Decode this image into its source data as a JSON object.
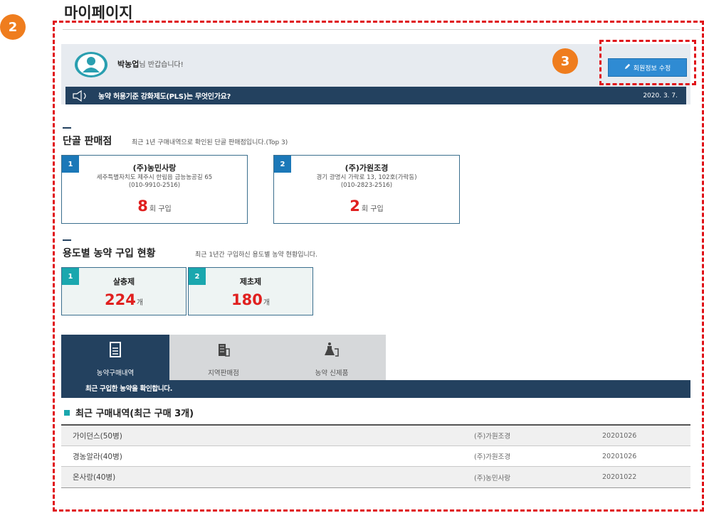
{
  "page": {
    "title": "마이페이지"
  },
  "markers": [
    "2",
    "3"
  ],
  "welcome": {
    "user_name": "박농업",
    "greeting": "님 반갑습니다!",
    "edit_button": "회원정보 수정"
  },
  "notice": {
    "text": "농약 허용기준 강화제도(PLS)는 무엇인가요?",
    "date": "2020. 3. 7."
  },
  "regular_stores": {
    "title": "단골 판매점",
    "subtitle": "최근 1년 구매내역으로 확인된 단골 판매점입니다.(Top 3)",
    "items": [
      {
        "rank": "1",
        "name": "(주)농민사랑",
        "address": "세주특별자치도 제주시 한림읍 금능농공길 65",
        "phone": "(010-9910-2516)",
        "count": "8",
        "unit": "회 구입"
      },
      {
        "rank": "2",
        "name": "(주)가원조경",
        "address": "경기 광명시 가락로 13, 102호(가락동)",
        "phone": "(010-2823-2516)",
        "count": "2",
        "unit": "회 구입"
      }
    ]
  },
  "usage": {
    "title": "용도별 농약 구입 현황",
    "subtitle": "최근 1년간 구입하신 용도별 농약 현황입니다.",
    "items": [
      {
        "rank": "1",
        "name": "살충제",
        "count": "224",
        "unit": "개"
      },
      {
        "rank": "2",
        "name": "제초제",
        "count": "180",
        "unit": "개"
      }
    ]
  },
  "tabs": {
    "items": [
      {
        "label": "농약구매내역",
        "icon": "document-icon"
      },
      {
        "label": "지역판매점",
        "icon": "building-icon"
      },
      {
        "label": "농약 신제품",
        "icon": "flask-icon"
      }
    ],
    "description": "최근 구입한 농약을 확인합니다."
  },
  "recent": {
    "title": "최근 구매내역(최근 구매 3개)",
    "rows": [
      {
        "product": "가이던스(50병)",
        "store": "(주)가원조경",
        "date": "20201026"
      },
      {
        "product": "경농알라(40병)",
        "store": "(주)가원조경",
        "date": "20201026"
      },
      {
        "product": "온사랑(40병)",
        "store": "(주)농민사랑",
        "date": "20201022"
      }
    ]
  },
  "colors": {
    "accent": "#ef7d1e",
    "navy": "#23415f",
    "highlight": "#e0141a",
    "count": "#e0201f"
  }
}
